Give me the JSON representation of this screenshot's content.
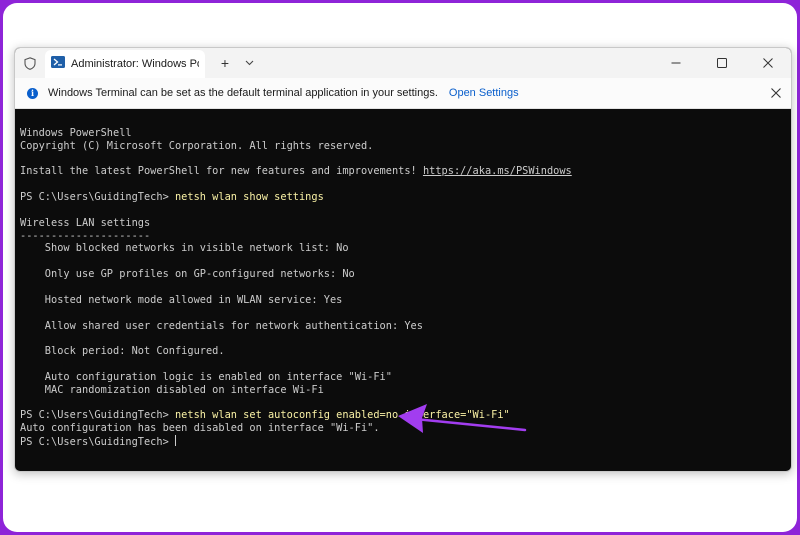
{
  "window": {
    "tab_title": "Administrator: Windows PowerShell",
    "new_tab_label": "+",
    "dropdown_label": "⌄"
  },
  "infobar": {
    "message": "Windows Terminal can be set as the default terminal application in your settings.",
    "link": "Open Settings"
  },
  "terminal": {
    "header1": "Windows PowerShell",
    "header2": "Copyright (C) Microsoft Corporation. All rights reserved.",
    "install_text": "Install the latest PowerShell for new features and improvements! ",
    "install_url": "https://aka.ms/PSWindows",
    "prompt": "PS C:\\Users\\GuidingTech> ",
    "cmd1": "netsh wlan show settings",
    "section_title": "Wireless LAN settings",
    "section_rule": "---------------------",
    "settings": [
      "    Show blocked networks in visible network list: No",
      "    Only use GP profiles on GP-configured networks: No",
      "    Hosted network mode allowed in WLAN service: Yes",
      "    Allow shared user credentials for network authentication: Yes",
      "    Block period: Not Configured.",
      "    Auto configuration logic is enabled on interface \"Wi-Fi\"",
      "    MAC randomization disabled on interface Wi-Fi"
    ],
    "cmd2": "netsh wlan set autoconfig enabled=no interface=\"Wi-Fi\"",
    "result": "Auto configuration has been disabled on interface \"Wi-Fi\".",
    "final_prompt": "PS C:\\Users\\GuidingTech>"
  },
  "colors": {
    "background": "#8e24d8",
    "terminal_bg": "#0c0c0c",
    "command_text": "#f9f1a5",
    "annotation_arrow": "#a23df0"
  }
}
